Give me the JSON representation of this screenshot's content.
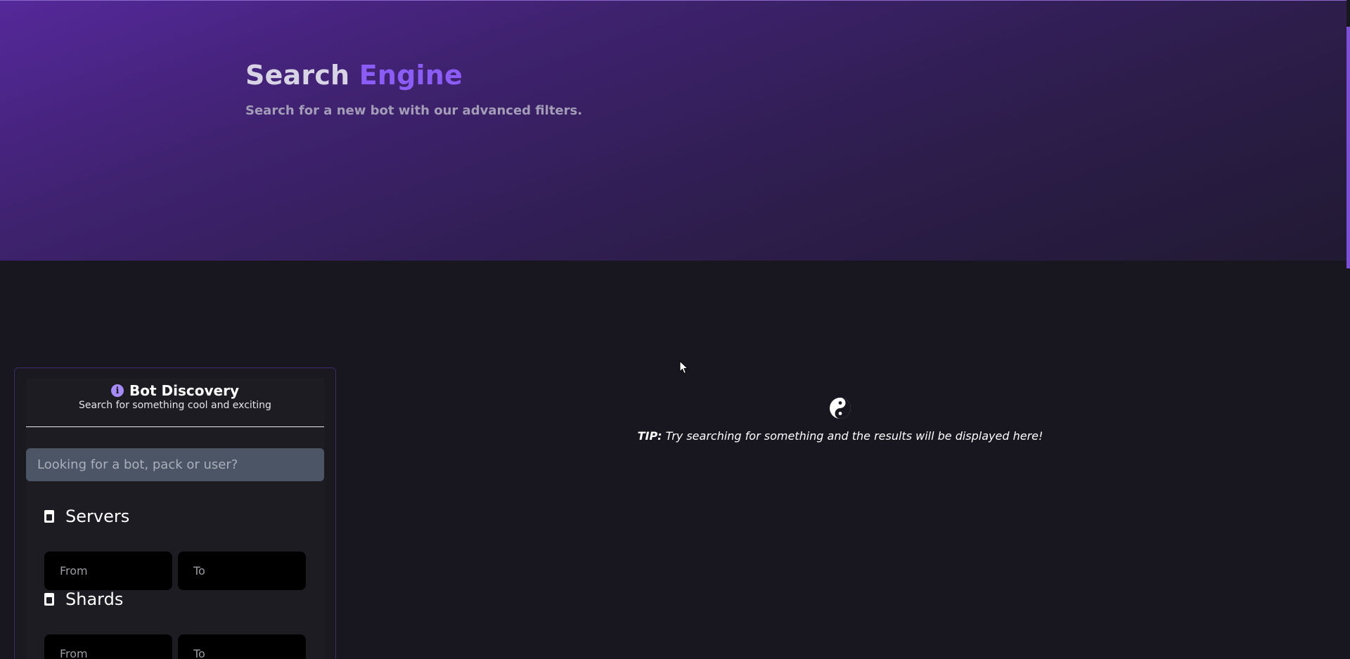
{
  "hero": {
    "title_main": "Search",
    "title_accent": "Engine",
    "subtitle": "Search for a new bot with our advanced filters."
  },
  "panel": {
    "title": "Bot Discovery",
    "subtitle": "Search for something cool and exciting",
    "search_placeholder": "Looking for a bot, pack or user?",
    "filters": [
      {
        "label": "Servers",
        "from_placeholder": "From",
        "to_placeholder": "To"
      },
      {
        "label": "Shards",
        "from_placeholder": "From",
        "to_placeholder": "To"
      }
    ]
  },
  "tip": {
    "prefix": "TIP:",
    "text": " Try searching for something and the results will be displayed here!"
  },
  "colors": {
    "accent": "#8b5cf6",
    "background": "#18161f",
    "input_bg": "#4b5565"
  },
  "icons": {
    "info": "info-icon",
    "filter": "filter-icon",
    "tip": "yin-yang-icon",
    "cursor": "mouse-cursor-icon"
  }
}
